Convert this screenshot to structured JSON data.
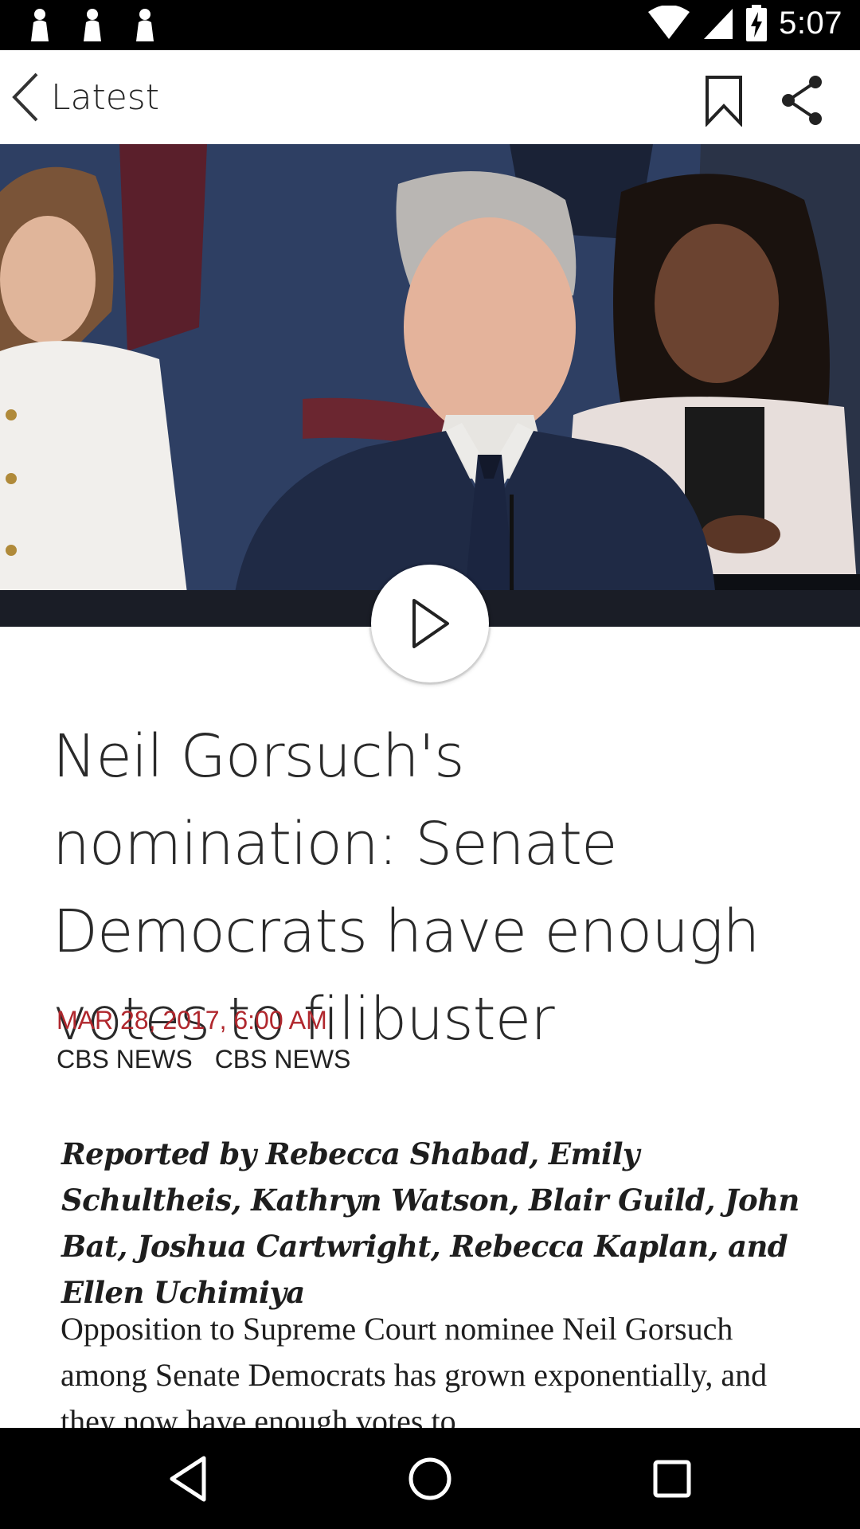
{
  "status_bar": {
    "time": "5:07",
    "notification_icons": [
      "person-notification-icon",
      "person-notification-icon",
      "person-notification-icon"
    ],
    "indicators": [
      "wifi-icon",
      "cell-signal-icon",
      "battery-charging-icon"
    ]
  },
  "app_bar": {
    "back_label": "Latest",
    "actions": [
      "bookmark-icon",
      "share-icon"
    ]
  },
  "hero": {
    "media": "video-thumbnail",
    "play_icon": "play-icon"
  },
  "article": {
    "headline": "Neil Gorsuch's nomination: Senate Democrats have enough votes to filibuster",
    "date": "MAR 28, 2017, 6:00 AM",
    "sources": [
      "CBS NEWS",
      "CBS NEWS"
    ],
    "byline": "Reported by Rebecca Shabad, Emily Schultheis, Kathryn Watson, Blair Guild, John Bat, Joshua Cartwright, Rebecca Kaplan, and Ellen Uchimiya",
    "body": "Opposition to Supreme Court nominee Neil Gorsuch among Senate Democrats has grown exponentially, and they now have enough votes to"
  },
  "nav_bar": {
    "buttons": [
      "back-triangle-icon",
      "home-circle-icon",
      "recents-square-icon"
    ]
  },
  "colors": {
    "accent_date": "#b0272d",
    "status_bar": "#000000",
    "nav_bar": "#000000"
  }
}
